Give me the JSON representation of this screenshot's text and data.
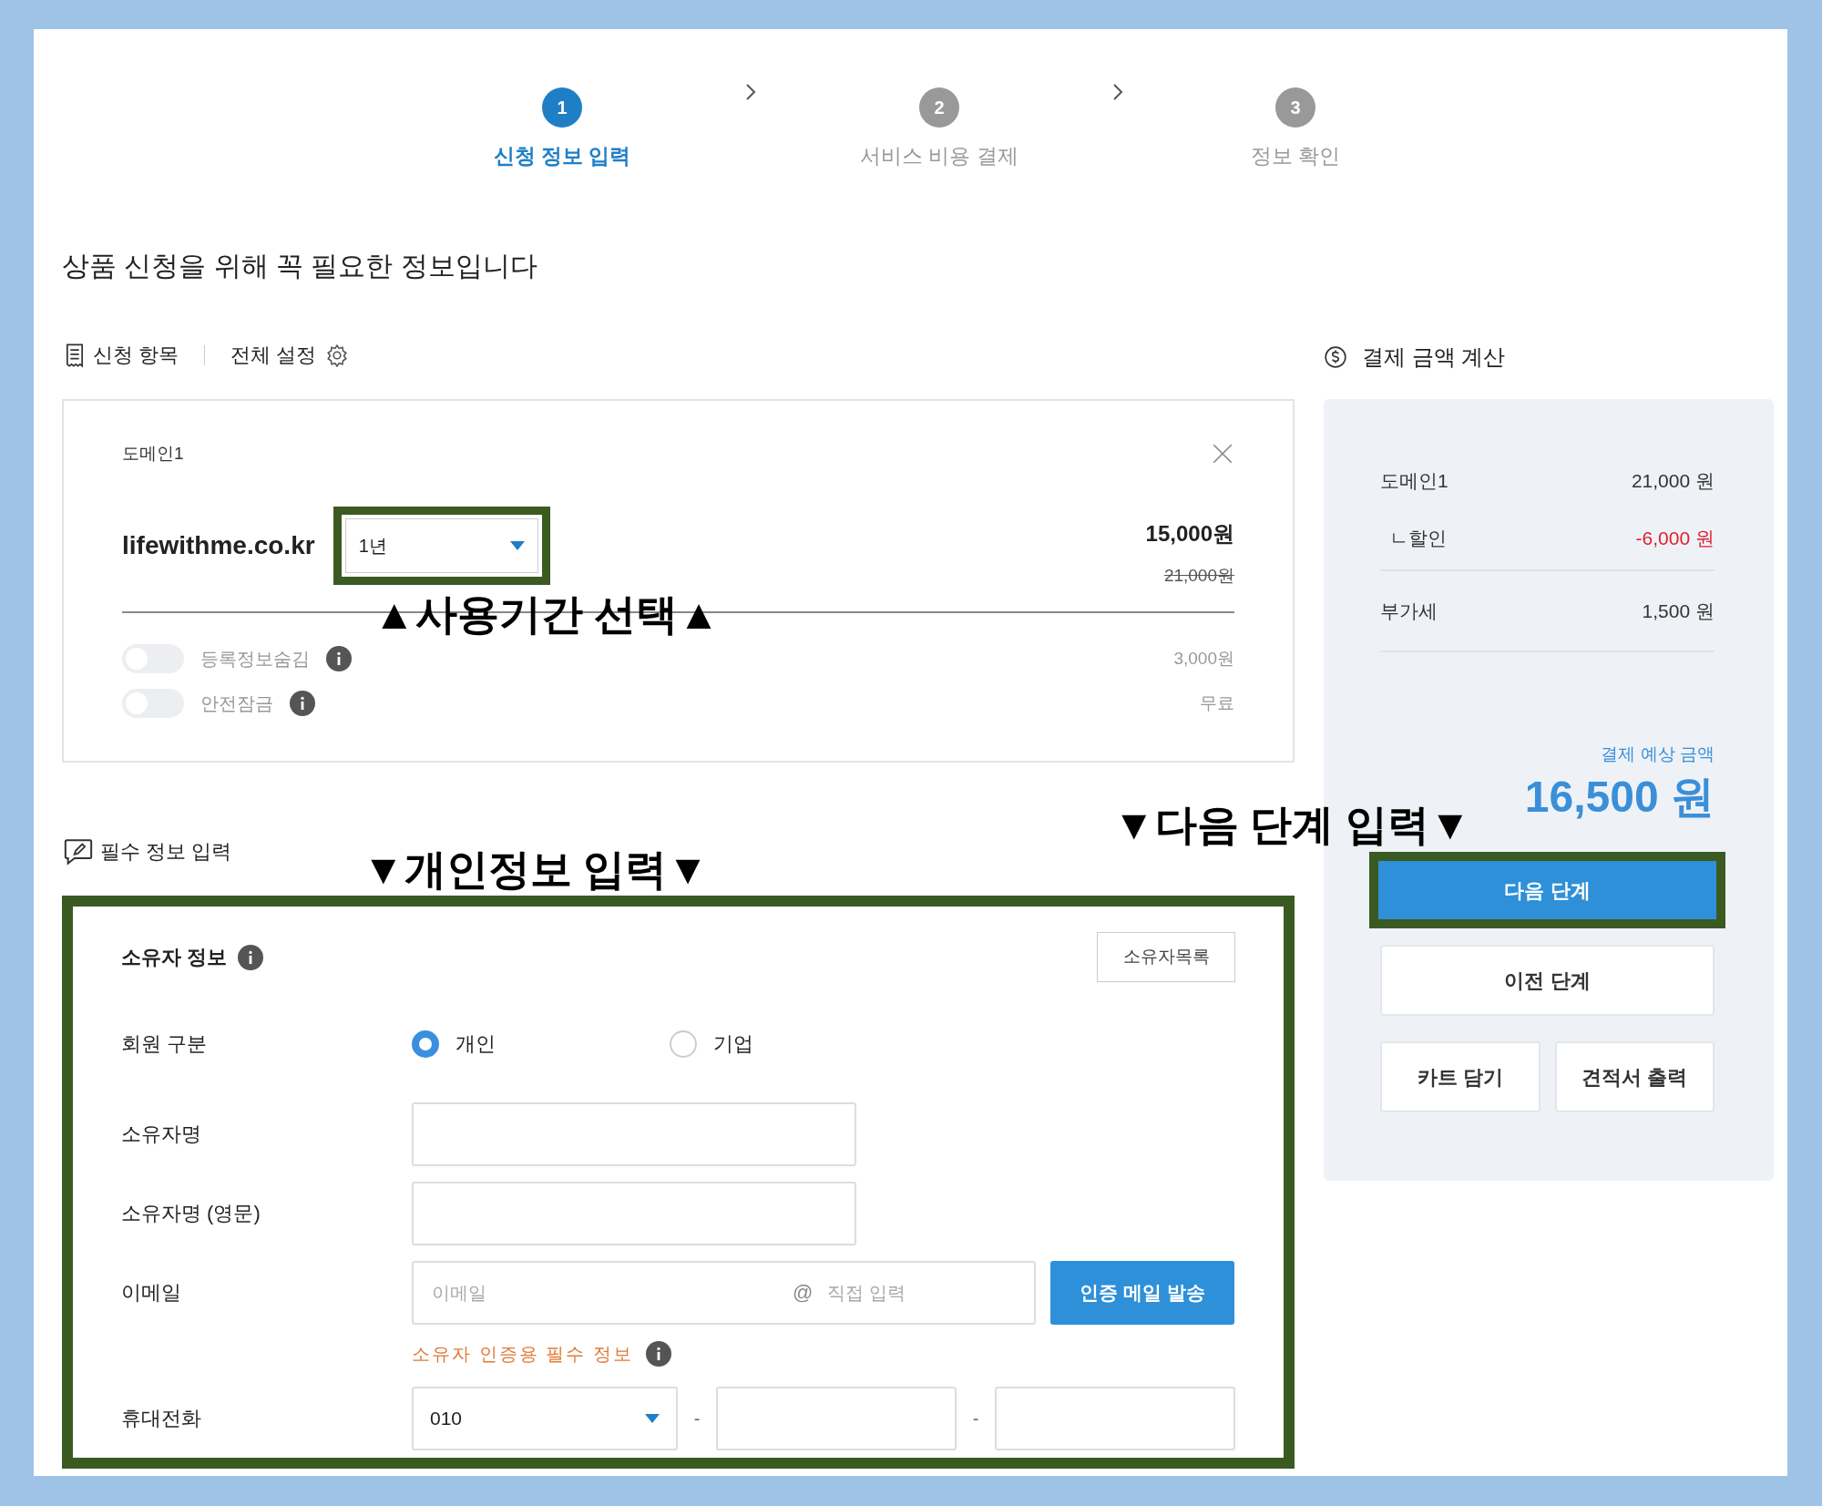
{
  "steps": [
    {
      "number": "1",
      "label": "신청 정보 입력",
      "selected": true
    },
    {
      "number": "2",
      "label": "서비스 비용 결제",
      "selected": false
    },
    {
      "number": "3",
      "label": "정보 확인",
      "selected": false
    }
  ],
  "heading": "상품 신청을 위해 꼭 필요한 정보입니다",
  "toolbar": {
    "items_label": "신청 항목",
    "settings_label": "전체 설정"
  },
  "domain_card": {
    "title": "도메인1",
    "domain": "lifewithme.co.kr",
    "period": "1년",
    "period_highlighted": true,
    "price": "15,000원",
    "original_price": "21,000원",
    "options": [
      {
        "label": "등록정보숨김",
        "on": false,
        "price": "3,000원"
      },
      {
        "label": "안전잠금",
        "on": false,
        "price": "무료"
      }
    ]
  },
  "summary": {
    "title": "결제 금액 계산",
    "groups": [
      [
        {
          "label": "도메인1",
          "amount": "21,000 원",
          "kind": "item"
        },
        {
          "label": "ㄴ할인",
          "amount": "-6,000 원",
          "kind": "discount"
        }
      ],
      [
        {
          "label": "부가세",
          "amount": "1,500 원",
          "kind": "item"
        }
      ]
    ],
    "total_label": "결제 예상 금액",
    "total": "16,500 원",
    "buttons": [
      {
        "label": "다음 단계",
        "kind": "primary",
        "highlighted": true
      },
      {
        "label": "이전 단계",
        "kind": "secondary",
        "highlighted": false
      },
      {
        "label": "카트 담기",
        "kind": "half",
        "highlighted": false
      },
      {
        "label": "견적서 출력",
        "kind": "half",
        "highlighted": false
      }
    ]
  },
  "required_section": {
    "title": "필수 정보 입력",
    "highlighted": true,
    "owner_title": "소유자 정보",
    "owner_list_button": "소유자목록",
    "rows": [
      {
        "kind": "radio",
        "label": "회원 구분",
        "options": [
          {
            "label": "개인",
            "selected": true
          },
          {
            "label": "기업",
            "selected": false
          }
        ]
      },
      {
        "kind": "text",
        "label": "소유자명"
      },
      {
        "kind": "text",
        "label": "소유자명 (영문)"
      },
      {
        "kind": "email",
        "label": "이메일",
        "placeholder": "이메일",
        "at": "@",
        "domain_placeholder": "직접 입력",
        "button": "인증 메일 발송",
        "note": "소유자 인증용 필수 정보"
      },
      {
        "kind": "phone",
        "label": "휴대전화",
        "prefix": "010",
        "separators": [
          "-",
          "-"
        ]
      }
    ]
  },
  "annotations": [
    {
      "text": "▲사용기간 선택▲"
    },
    {
      "text": "▼개인정보 입력▼"
    },
    {
      "text": "▼다음 단계 입력▼"
    }
  ]
}
